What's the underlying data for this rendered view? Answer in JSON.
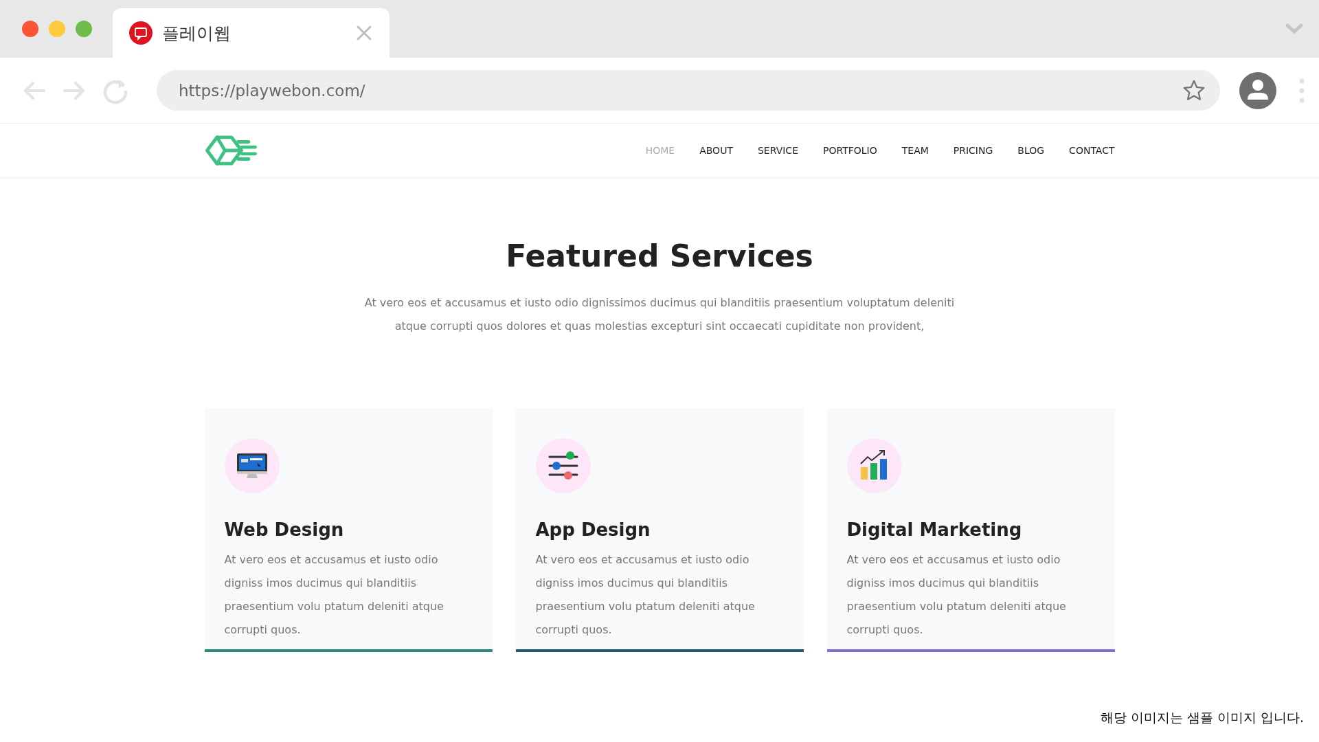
{
  "browser": {
    "tab_title": "플레이웹",
    "url": "https://playwebon.com/"
  },
  "nav": [
    {
      "label": "HOME",
      "selected": true
    },
    {
      "label": "ABOUT",
      "selected": false
    },
    {
      "label": "SERVICE",
      "selected": false
    },
    {
      "label": "PORTFOLIO",
      "selected": false
    },
    {
      "label": "TEAM",
      "selected": false
    },
    {
      "label": "PRICING",
      "selected": false
    },
    {
      "label": "BLOG",
      "selected": false
    },
    {
      "label": "CONTACT",
      "selected": false
    }
  ],
  "section": {
    "title": "Featured Services",
    "description": "At vero eos et accusamus et iusto odio dignissimos ducimus qui blanditiis praesentium voluptatum deleniti atque corrupti quos dolores et quas molestias excepturi sint occaecati cupiditate non provident,"
  },
  "cards": [
    {
      "kind": "monitor",
      "title": "Web Design",
      "text": "At vero eos et accusamus et iusto odio digniss imos ducimus qui blanditiis praesentium volu ptatum deleniti atque corrupti quos.",
      "color": "#2e8b7c"
    },
    {
      "kind": "sliders",
      "title": "App Design",
      "text": "At vero eos et accusamus et iusto odio digniss imos ducimus qui blanditiis praesentium volu ptatum deleniti atque corrupti quos.",
      "color": "#1f5a66"
    },
    {
      "kind": "chart",
      "title": "Digital Marketing",
      "text": "At vero eos et accusamus et iusto odio digniss imos ducimus qui blanditiis praesentium volu ptatum deleniti atque corrupti quos.",
      "color": "#7a73d1"
    }
  ],
  "footnote": "해당 이미지는 샘플 이미지 입니다."
}
